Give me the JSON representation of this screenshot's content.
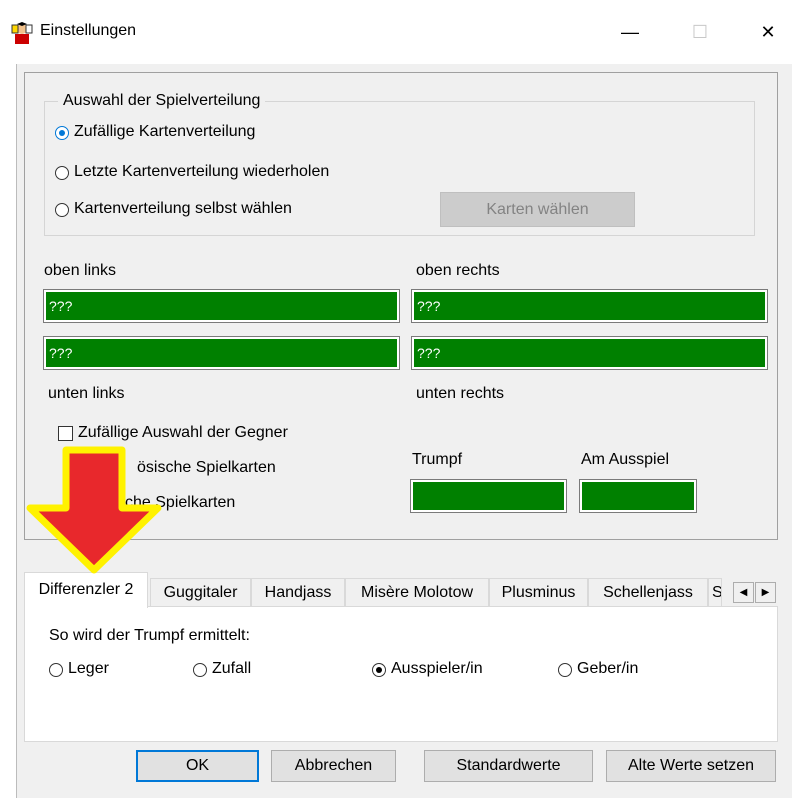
{
  "window": {
    "title": "Einstellungen",
    "minimize": "—",
    "maximize": "☐",
    "close": "✕"
  },
  "distribution": {
    "legend": "Auswahl der Spielverteilung",
    "options": [
      {
        "label": "Zufällige Kartenverteilung",
        "selected": true
      },
      {
        "label": "Letzte Kartenverteilung wiederholen",
        "selected": false
      },
      {
        "label": "Kartenverteilung selbst wählen",
        "selected": false
      }
    ],
    "choose_cards_button": "Karten wählen"
  },
  "players": {
    "top_left_label": "oben links",
    "top_right_label": "oben rechts",
    "bottom_left_label": "unten links",
    "bottom_right_label": "unten rechts",
    "top_left_value": "???",
    "top_right_value": "???",
    "bottom_left_value": "???",
    "bottom_right_value": "???"
  },
  "options": {
    "random_opponents": "Zufällige Auswahl der Gegner",
    "french_cards_partial": "ösische Spielkarten",
    "german_cards_partial": "che Spielkarten"
  },
  "indicators": {
    "trump_label": "Trumpf",
    "lead_label": "Am Ausspiel"
  },
  "tabs": [
    {
      "label": "Differenzler 2",
      "active": true
    },
    {
      "label": "Guggitaler",
      "active": false
    },
    {
      "label": "Handjass",
      "active": false
    },
    {
      "label": "Misère Molotow",
      "active": false
    },
    {
      "label": "Plusminus",
      "active": false
    },
    {
      "label": "Schellenjass",
      "active": false
    },
    {
      "label": "S",
      "active": false
    }
  ],
  "tab_content": {
    "prompt": "So wird der Trumpf ermittelt:",
    "trump_options": [
      {
        "label": "Leger",
        "selected": false
      },
      {
        "label": "Zufall",
        "selected": false
      },
      {
        "label": "Ausspieler/in",
        "selected": true
      },
      {
        "label": "Geber/in",
        "selected": false
      }
    ]
  },
  "buttons": {
    "ok": "OK",
    "cancel": "Abbrechen",
    "defaults": "Standardwerte",
    "restore": "Alte Werte setzen"
  },
  "colors": {
    "field_green": "#008000",
    "arrow_red": "#e8282c",
    "arrow_yellow": "#fff200",
    "accent": "#0078d7"
  }
}
